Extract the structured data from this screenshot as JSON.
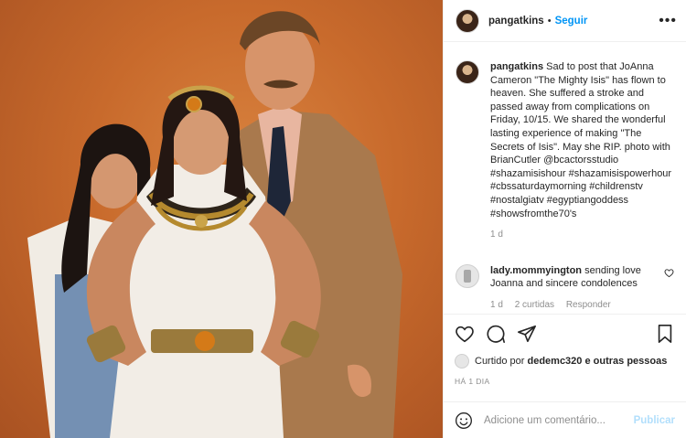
{
  "post": {
    "author": "pangatkins",
    "follow_label": "Seguir",
    "separator": "•",
    "more_label": "•••"
  },
  "caption": {
    "author": "pangatkins",
    "text": "Sad to post that JoAnna Cameron \"The Mighty Isis\" has flown to heaven. She suffered a stroke and passed away from complications on Friday, 10/15. We shared the wonderful lasting experience of making \"The Secrets of Isis\". May she RIP. photo with BrianCutler @bcactorsstudio #shazamisishour #shazamisispowerhour #cbssaturdaymorning #childrenstv #nostalgiatv #egyptiangoddess #showsfromthe70's",
    "time": "1 d"
  },
  "comments": [
    {
      "author": "lady.mommyington",
      "text": "sending love Joanna and sincere condolences",
      "time": "1 d",
      "likes": "2 curtidas",
      "reply_label": "Responder"
    }
  ],
  "likes": {
    "prefix": "Curtido por",
    "user": "dedemc320",
    "suffix": "e outras pessoas"
  },
  "posted_ago": "HÁ 1 DIA",
  "add_comment": {
    "placeholder": "Adicione um comentário...",
    "post_label": "Publicar"
  },
  "icons": {
    "like": "heart-icon",
    "comment": "comment-icon",
    "share": "share-icon",
    "save": "bookmark-icon",
    "emoji": "emoji-icon",
    "comment_like": "heart-icon"
  },
  "colors": {
    "accent": "#0095f6",
    "post_disabled": "#b2dffc",
    "muted": "#8e8e8e",
    "backdrop": "#c86a2c"
  }
}
